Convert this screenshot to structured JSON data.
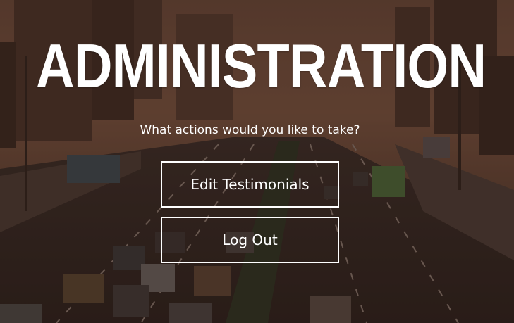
{
  "page": {
    "title": "ADMINISTRATION",
    "subtitle": "What actions would you like to take?"
  },
  "actions": {
    "edit_testimonials_label": "Edit Testimonials",
    "log_out_label": "Log Out"
  },
  "colors": {
    "text": "#ffffff",
    "button_border": "#ffffff",
    "background_tint": "#3a2a22"
  }
}
